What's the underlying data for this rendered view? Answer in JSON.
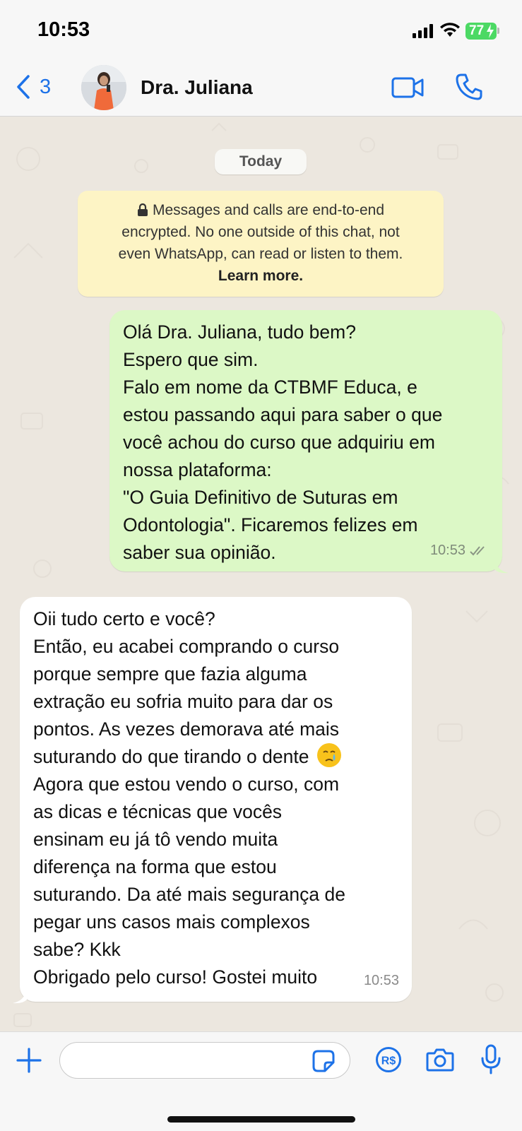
{
  "status_bar": {
    "time": "10:53",
    "battery": "77"
  },
  "header": {
    "back_count": "3",
    "contact_name": "Dra. Juliana"
  },
  "chat": {
    "date_label": "Today",
    "encryption_lines": [
      "Messages and calls are end-to-end",
      "encrypted. No one outside of this chat, not",
      "even WhatsApp, can read or listen to them."
    ],
    "encryption_link": "Learn more.",
    "outgoing": {
      "lines": [
        "Olá Dra. Juliana, tudo bem?",
        "Espero que sim.",
        "Falo em nome da CTBMF Educa, e",
        "estou passando aqui para saber o que",
        "você achou do curso que adquiriu em",
        "nossa plataforma:",
        "\"O Guia Definitivo de Suturas em",
        "Odontologia\". Ficaremos felizes em",
        "saber sua opinião."
      ],
      "time": "10:53"
    },
    "incoming": {
      "lines": [
        "Oii tudo certo e você?",
        "Então, eu acabei comprando o curso",
        "porque sempre que fazia alguma",
        "extração eu sofria muito para dar os",
        "pontos. As vezes demorava até mais",
        "suturando do que tirando o dente",
        "Agora que estou vendo o curso, com",
        "as dicas e técnicas que vocês",
        "ensinam eu já tô vendo muita",
        "diferença na forma que estou",
        "suturando. Da até mais segurança de",
        "pegar uns casos mais complexos",
        "sabe? Kkk",
        "Obrigado pelo curso! Gostei muito"
      ],
      "time": "10:53"
    }
  },
  "input_bar": {
    "input_value": "",
    "pay_label": "R$"
  },
  "icons": {
    "back": "chevron-left-icon",
    "video": "video-camera-icon",
    "call": "phone-icon",
    "plus": "plus-icon",
    "sticker": "sticker-icon",
    "pay": "payment-icon",
    "camera": "camera-icon",
    "mic": "microphone-icon"
  },
  "colors": {
    "accent": "#1d72e8",
    "outgoing_bubble": "#dcf8c6",
    "encryption_notice": "#fdf4c5",
    "battery": "#4cd964"
  }
}
